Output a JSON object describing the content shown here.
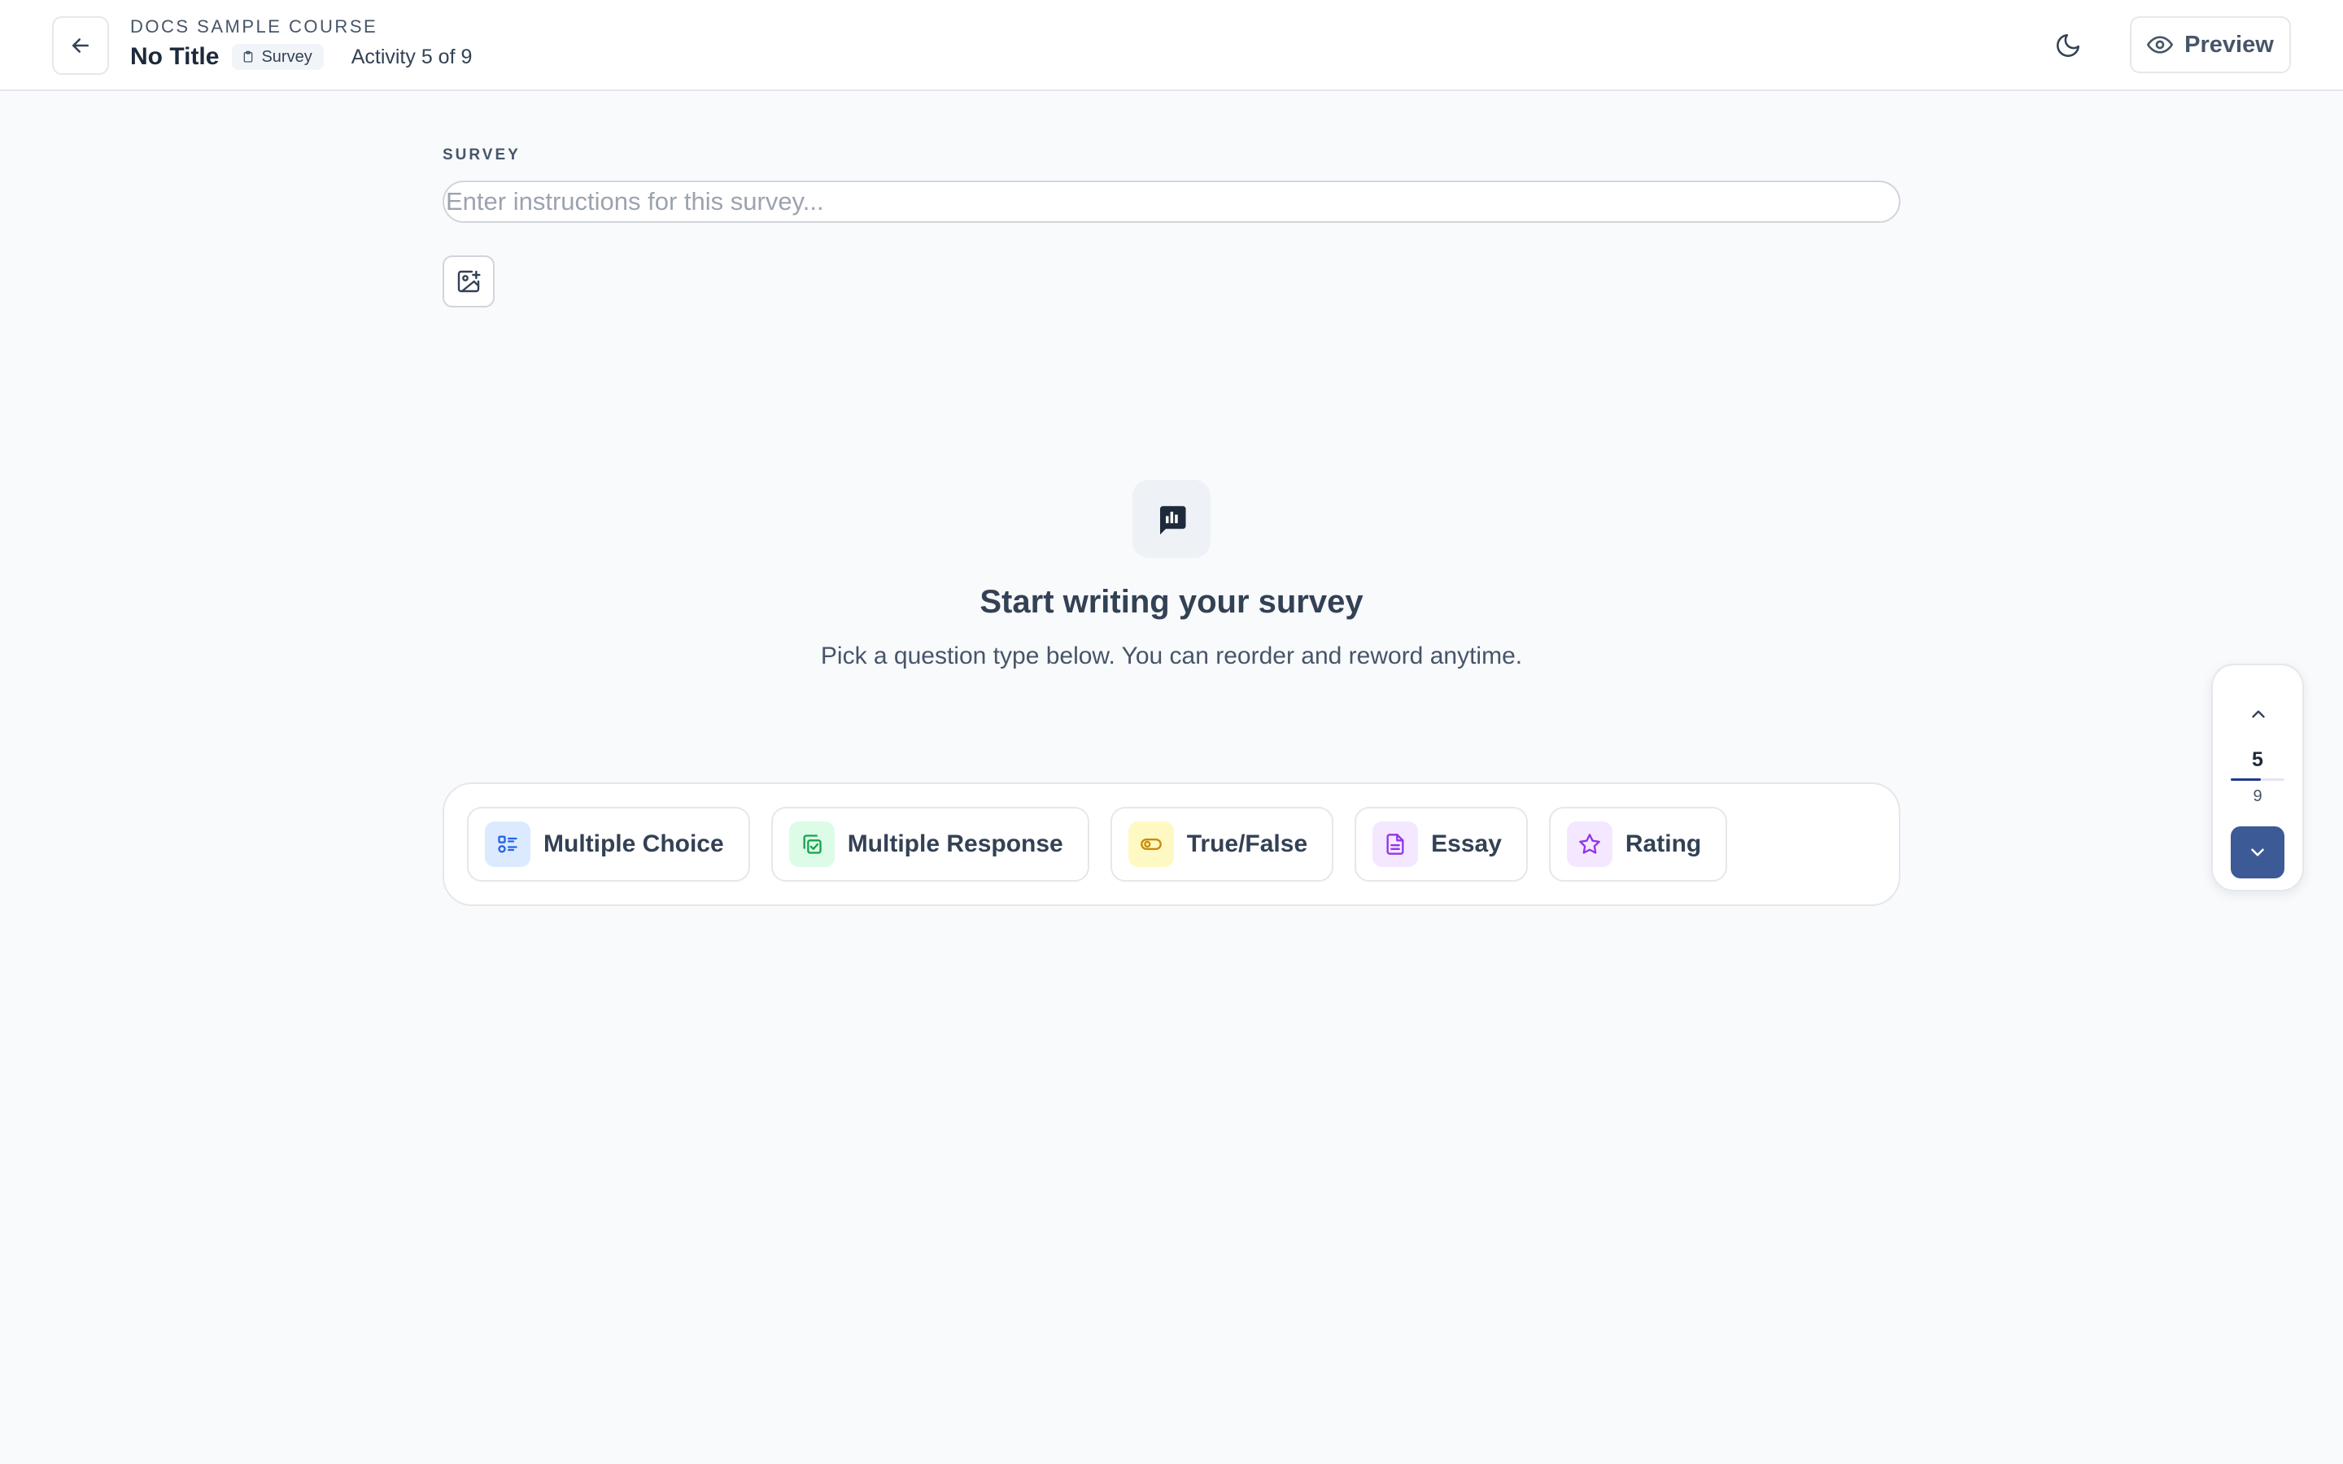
{
  "header": {
    "course_name": "DOCS SAMPLE COURSE",
    "title": "No Title",
    "type_badge": "Survey",
    "activity_position": "Activity 5 of 9",
    "preview_label": "Preview",
    "back_icon": "arrow-left-icon",
    "theme_icon": "moon-icon"
  },
  "editor": {
    "section_label": "SURVEY",
    "instructions": {
      "value": "",
      "placeholder": "Enter instructions for this survey..."
    },
    "add_image_icon": "image-plus-icon"
  },
  "empty_state": {
    "icon": "survey-chart-icon",
    "heading": "Start writing your survey",
    "subtext": "Pick a question type below. You can reorder and reword anytime."
  },
  "question_types": [
    {
      "label": "Multiple Choice",
      "icon": "list-icon",
      "color": "#2563eb",
      "bg": "#dbeafe"
    },
    {
      "label": "Multiple Response",
      "icon": "copy-check-icon",
      "color": "#16a34a",
      "bg": "#dcfce7"
    },
    {
      "label": "True/False",
      "icon": "toggle-icon",
      "color": "#ca8a04",
      "bg": "#fef9c3"
    },
    {
      "label": "Essay",
      "icon": "document-icon",
      "color": "#9333ea",
      "bg": "#f3e8ff"
    },
    {
      "label": "Rating",
      "icon": "star-icon",
      "color": "#9333ea",
      "bg": "#f3e8ff"
    }
  ],
  "activity_nav": {
    "current": "5",
    "total": "9",
    "progress_fraction": 0.556,
    "accent": "#3c5a96"
  }
}
